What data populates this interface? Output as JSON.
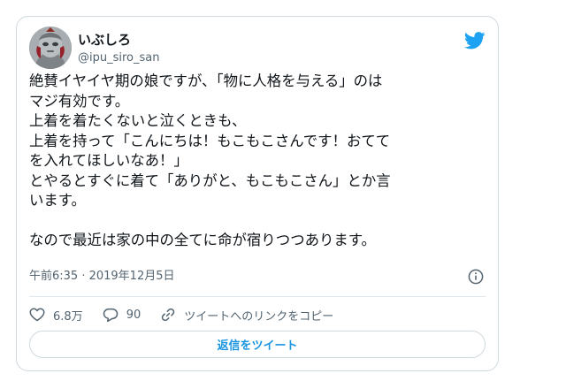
{
  "user": {
    "name": "いぶしろ",
    "handle": "@ipu_siro_san"
  },
  "tweet": {
    "text": "絶賛イヤイヤ期の娘ですが、「物に人格を与える」のは\nマジ有効です。\n上着を着たくないと泣くときも、\n上着を持って「こんにちは！もこもこさんです！おてて\nを入れてほしいなあ！」\nとやるとすぐに着て「ありがと、もこもこさん」とか言\nいます。\n\nなので最近は家の中の全てに命が宿りつつあります。",
    "timestamp": "午前6:35 · 2019年12月5日"
  },
  "actions": {
    "likes": "6.8万",
    "replies": "90",
    "copy_link": "ツイートへのリンクをコピー"
  },
  "reply_button": "返信をツイート",
  "icons": {
    "logo": "twitter-bird-icon",
    "info": "info-icon",
    "like": "heart-icon",
    "reply": "speech-bubble-icon",
    "link": "link-icon"
  },
  "colors": {
    "brand": "#1da1f2",
    "link": "#1b95e0",
    "secondary_text": "#536471",
    "border": "#cfd9de"
  }
}
